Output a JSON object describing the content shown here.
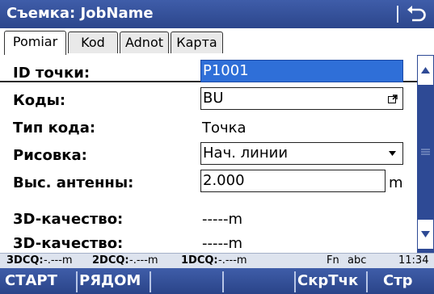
{
  "window": {
    "title": "Съемка: JobName"
  },
  "tabs": [
    {
      "label": "Pomiar",
      "active": true
    },
    {
      "label": "Kod",
      "active": false
    },
    {
      "label": "Adnot",
      "active": false
    },
    {
      "label": "Карта",
      "active": false
    }
  ],
  "form": {
    "point_id": {
      "label": "ID точки:",
      "value": "P1001"
    },
    "codes": {
      "label": "Коды:",
      "value": "BU"
    },
    "code_type": {
      "label": "Тип кода:",
      "value": "Точка"
    },
    "drawing": {
      "label": "Рисовка:",
      "value": "Нач. линии"
    },
    "antenna_height": {
      "label": "Выс. антенны:",
      "value": "2.000",
      "unit": "m"
    },
    "quality3d": {
      "label": "3D-качество:",
      "value": "-----m"
    },
    "quality3d_2": {
      "label": "3D-качество:",
      "value": "-----m"
    }
  },
  "status": {
    "dcq3d_label": "3DCQ:",
    "dcq3d_value": "-.---m",
    "dcq2d_label": "2DCQ:",
    "dcq2d_value": "-.---m",
    "dcq1d_label": "1DCQ:",
    "dcq1d_value": "-.---m",
    "fn": "Fn",
    "input_mode": "abc",
    "time": "11:34"
  },
  "softkeys": {
    "start": "СТАРТ",
    "near": "РЯДОМ",
    "hide_point": "СкрТчк",
    "page": "Стр"
  },
  "colors": {
    "bar": "#2e4a95",
    "selection": "#2f6fd8",
    "status_bg": "#dde3ee"
  }
}
